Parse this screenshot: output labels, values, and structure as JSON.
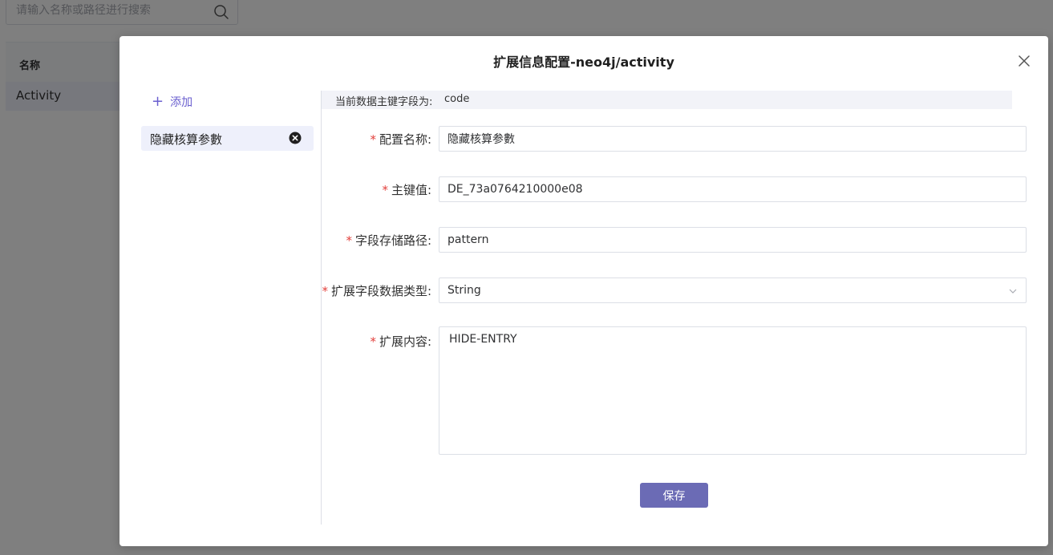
{
  "background": {
    "search_placeholder": "请输入名称或路径进行搜索",
    "table_header_name": "名称",
    "rows": [
      {
        "name": "Activity"
      }
    ]
  },
  "dialog": {
    "title": "扩展信息配置-neo4j/activity",
    "add_label": "添加",
    "config_items": [
      {
        "name": "隐藏核算参數"
      }
    ],
    "primary_key_label": "当前数据主键字段为:",
    "primary_key_value": "code",
    "required_mark": "*",
    "fields": {
      "config_name": {
        "label": "配置名称:",
        "value": "隐藏核算参數"
      },
      "primary_value": {
        "label": "主键值:",
        "value": "DE_73a0764210000e08"
      },
      "storage_path": {
        "label": "字段存储路径:",
        "value": "pattern"
      },
      "data_type": {
        "label": "扩展字段数据类型:",
        "value": "String"
      },
      "content": {
        "label": "扩展内容:",
        "value": "HIDE-ENTRY"
      }
    },
    "save_label": "保存"
  },
  "colors": {
    "accent": "#6a5fcf",
    "save_button": "#6b6bb5",
    "required": "#e2403c",
    "selected_bg": "#eef0fb"
  }
}
